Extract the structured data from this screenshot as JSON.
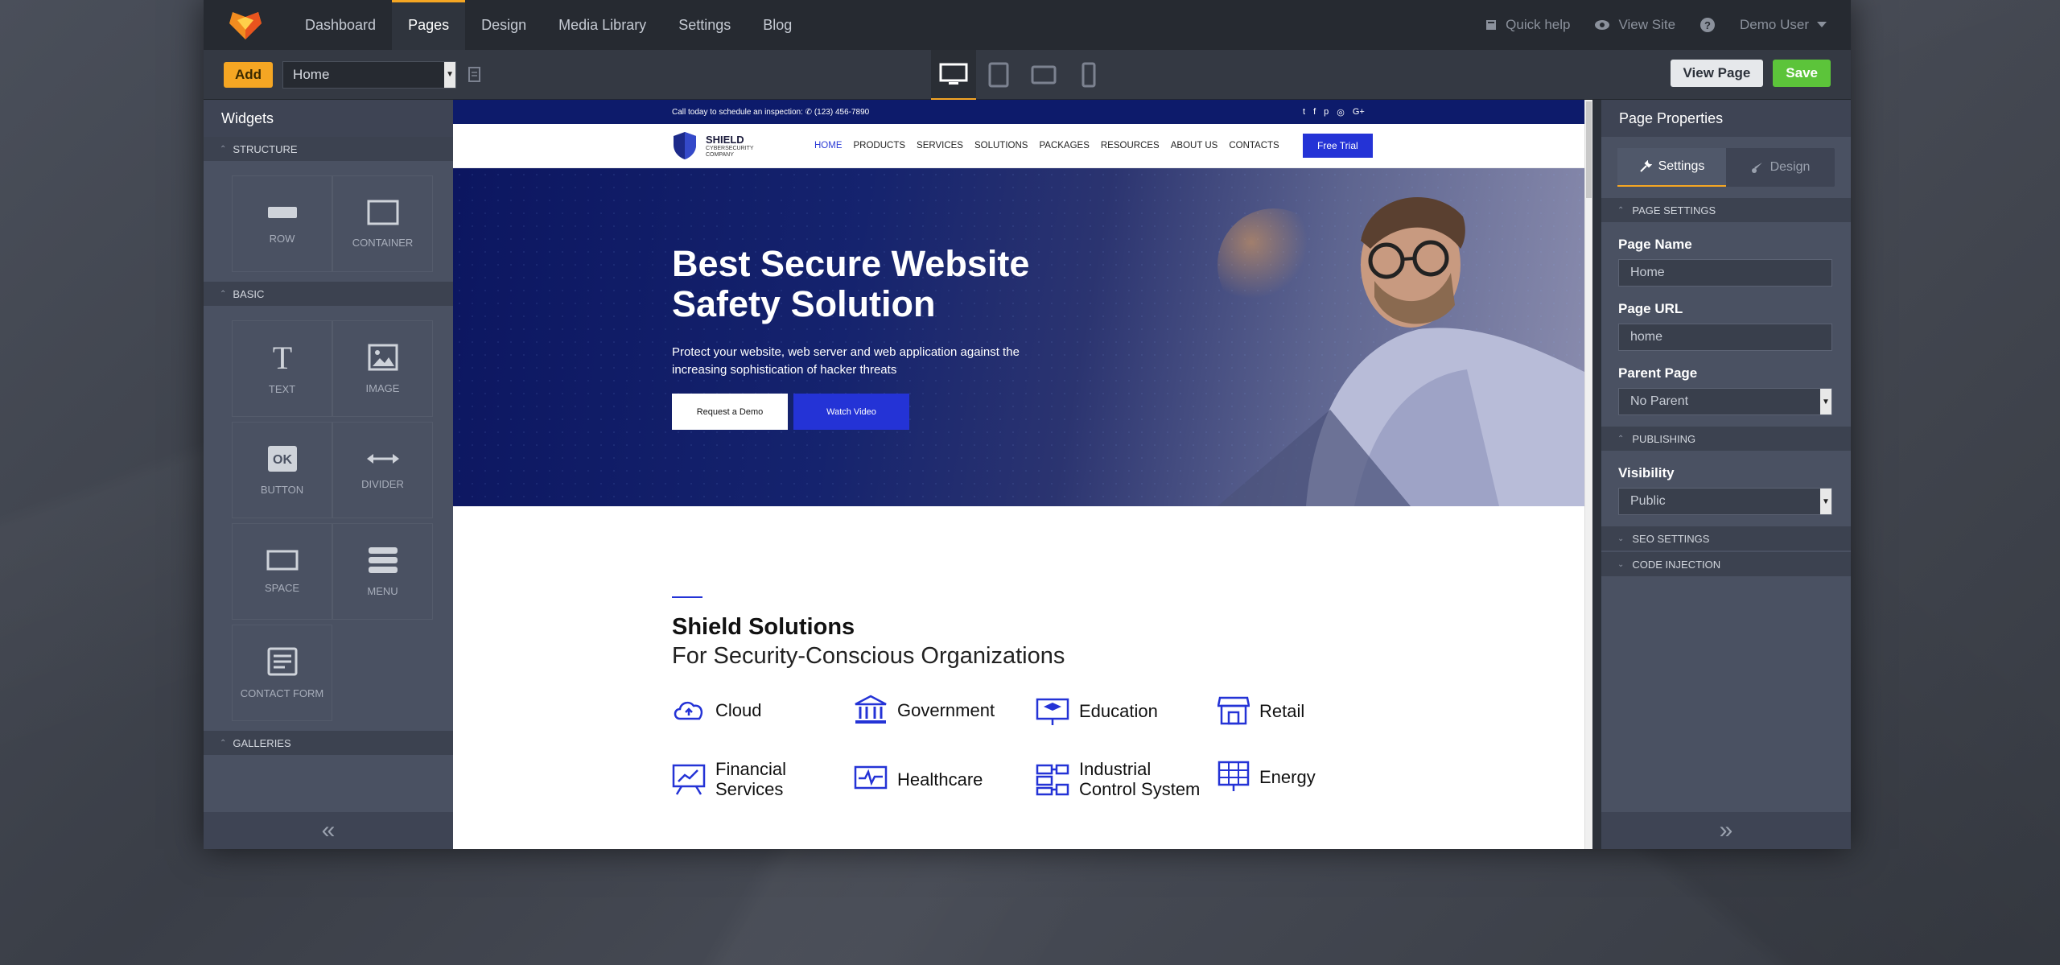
{
  "topnav": {
    "items": [
      "Dashboard",
      "Pages",
      "Design",
      "Media Library",
      "Settings",
      "Blog"
    ],
    "active_index": 1,
    "quick_help": "Quick help",
    "view_site": "View Site",
    "user": "Demo User"
  },
  "toolbar": {
    "add_label": "Add",
    "page_select_value": "Home",
    "view_page_label": "View Page",
    "save_label": "Save",
    "devices": [
      "desktop-icon",
      "tablet-icon",
      "tablet-landscape-icon",
      "phone-icon"
    ],
    "active_device": "desktop"
  },
  "widgets": {
    "title": "Widgets",
    "sections": {
      "structure": "STRUCTURE",
      "basic": "BASIC",
      "galleries": "GALLERIES"
    },
    "structure_items": [
      "ROW",
      "CONTAINER"
    ],
    "basic_items": [
      "TEXT",
      "IMAGE",
      "BUTTON",
      "DIVIDER",
      "SPACE",
      "MENU",
      "CONTACT FORM"
    ]
  },
  "properties": {
    "title": "Page Properties",
    "tab_settings": "Settings",
    "tab_design": "Design",
    "page_settings": "PAGE SETTINGS",
    "page_name_label": "Page Name",
    "page_name_value": "Home",
    "page_url_label": "Page URL",
    "page_url_value": "home",
    "parent_page_label": "Parent Page",
    "parent_page_value": "No Parent",
    "publishing": "PUBLISHING",
    "visibility_label": "Visibility",
    "visibility_value": "Public",
    "seo_settings": "SEO SETTINGS",
    "code_injection": "CODE INJECTION"
  },
  "site": {
    "call_text": "Call today to schedule an inspection:",
    "phone": "(123) 456-7890",
    "socials": [
      "twitter",
      "facebook",
      "pinterest",
      "instagram",
      "google-plus"
    ],
    "brand_name": "SHIELD",
    "brand_sub1": "CYBERSECURITY",
    "brand_sub2": "COMPANY",
    "menu": [
      "HOME",
      "PRODUCTS",
      "SERVICES",
      "SOLUTIONS",
      "PACKAGES",
      "RESOURCES",
      "ABOUT US",
      "CONTACTS"
    ],
    "trial": "Free Trial",
    "hero_title_1": "Best Secure Website",
    "hero_title_2": "Safety Solution",
    "hero_sub_1": "Protect your website, web server and web application against the",
    "hero_sub_2": "increasing sophistication of hacker threats",
    "btn_demo": "Request a Demo",
    "btn_video": "Watch Video",
    "sol_title": "Shield Solutions",
    "sol_subtitle": "For Security-Conscious Organizations",
    "cats": [
      "Cloud",
      "Government",
      "Education",
      "Retail",
      "Financial",
      "Services",
      "Healthcare",
      "Industrial",
      "Control System",
      "Energy"
    ]
  },
  "colors": {
    "accent": "#f5a623",
    "save": "#5cc43a",
    "brand_blue": "#2433d6",
    "navy": "#0d1b6b"
  }
}
